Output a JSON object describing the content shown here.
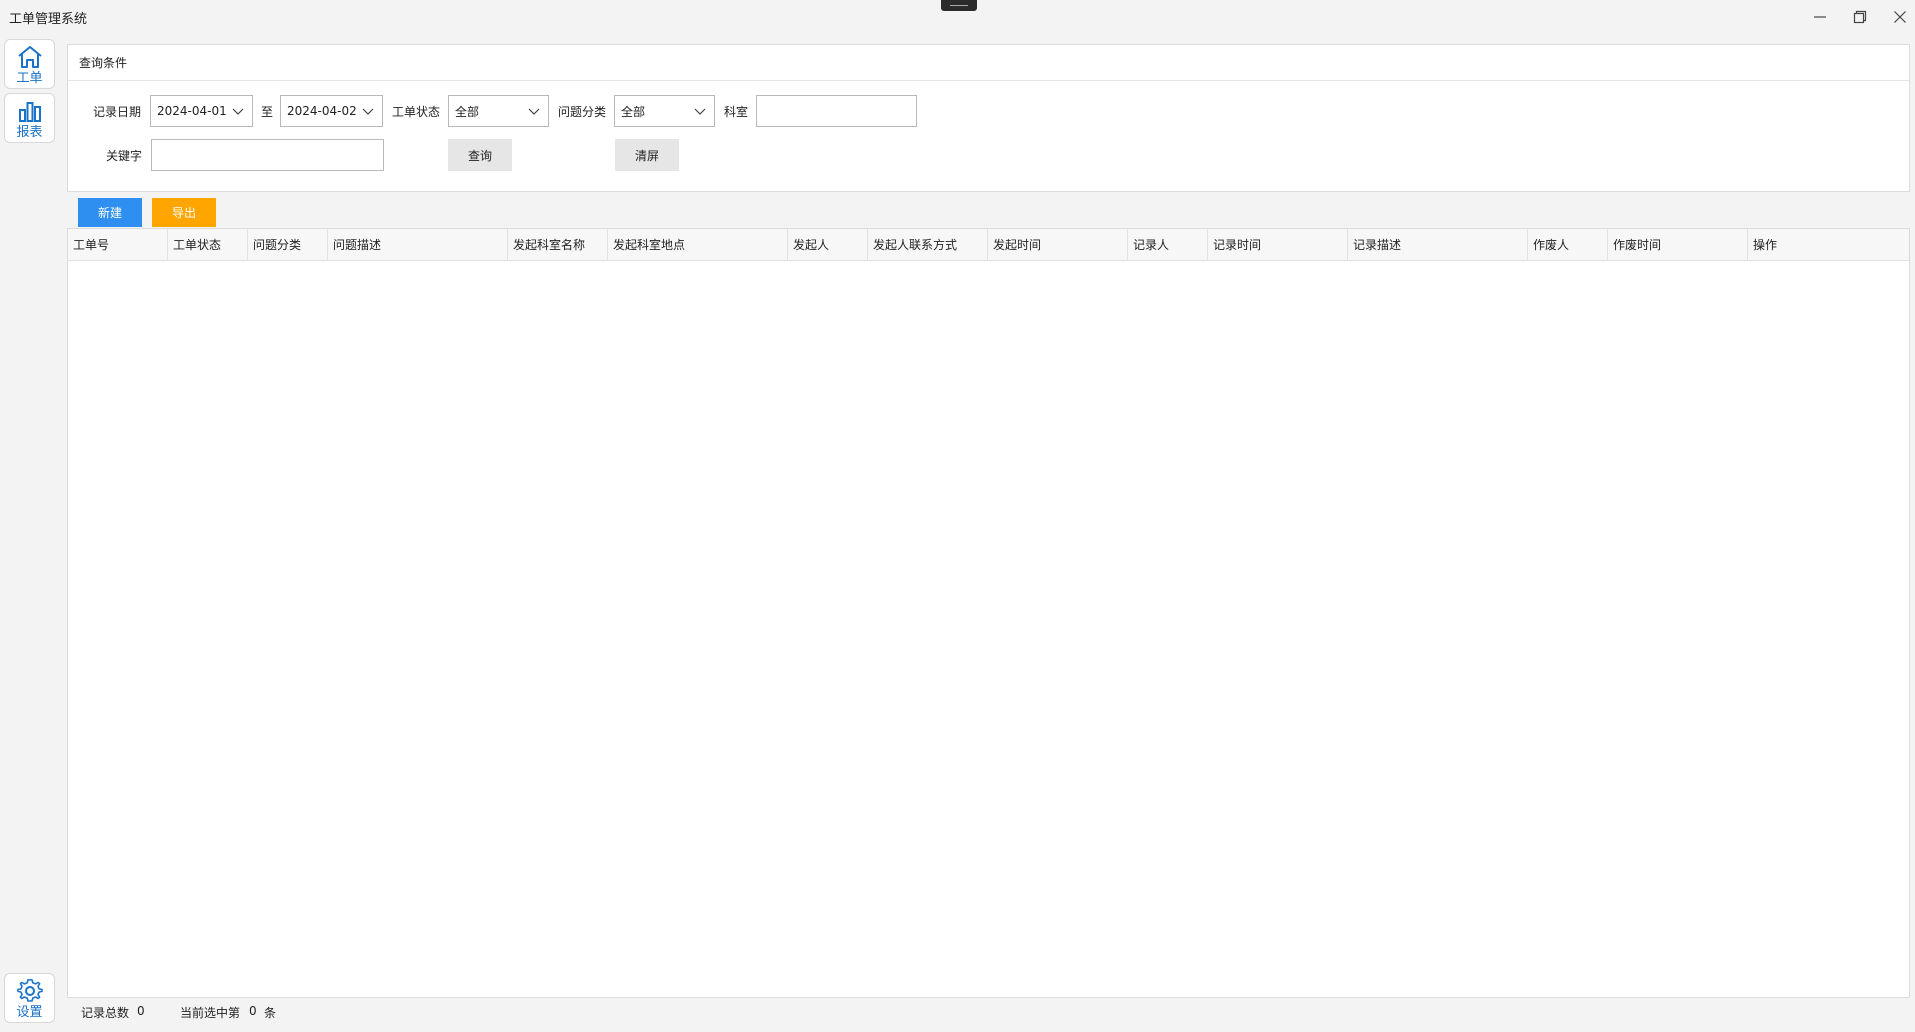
{
  "window": {
    "title": "工单管理系统"
  },
  "sidebar": {
    "items": [
      {
        "label": "工单",
        "icon": "home-icon"
      },
      {
        "label": "报表",
        "icon": "bar-chart-icon"
      }
    ],
    "bottom": {
      "label": "设置",
      "icon": "gear-icon"
    }
  },
  "query": {
    "title": "查询条件",
    "date_label": "记录日期",
    "date_from": "2024-04-01",
    "to_label": "至",
    "date_to": "2024-04-02",
    "status_label": "工单状态",
    "status_value": "全部",
    "category_label": "问题分类",
    "category_value": "全部",
    "dept_label": "科室",
    "dept_value": "",
    "keyword_label": "关键字",
    "keyword_value": "",
    "search_button": "查询",
    "clear_button": "清屏"
  },
  "actions": {
    "new_button": "新建",
    "export_button": "导出",
    "new_color": "#2f8ff0",
    "export_color": "#ffa500"
  },
  "table": {
    "columns": [
      "工单号",
      "工单状态",
      "问题分类",
      "问题描述",
      "发起科室名称",
      "发起科室地点",
      "发起人",
      "发起人联系方式",
      "发起时间",
      "记录人",
      "记录时间",
      "记录描述",
      "作废人",
      "作废时间",
      "操作"
    ],
    "rows": []
  },
  "status": {
    "total_label": "记录总数",
    "total_value": "0",
    "selected_label": "当前选中第",
    "selected_value": "0",
    "selected_unit": "条"
  }
}
